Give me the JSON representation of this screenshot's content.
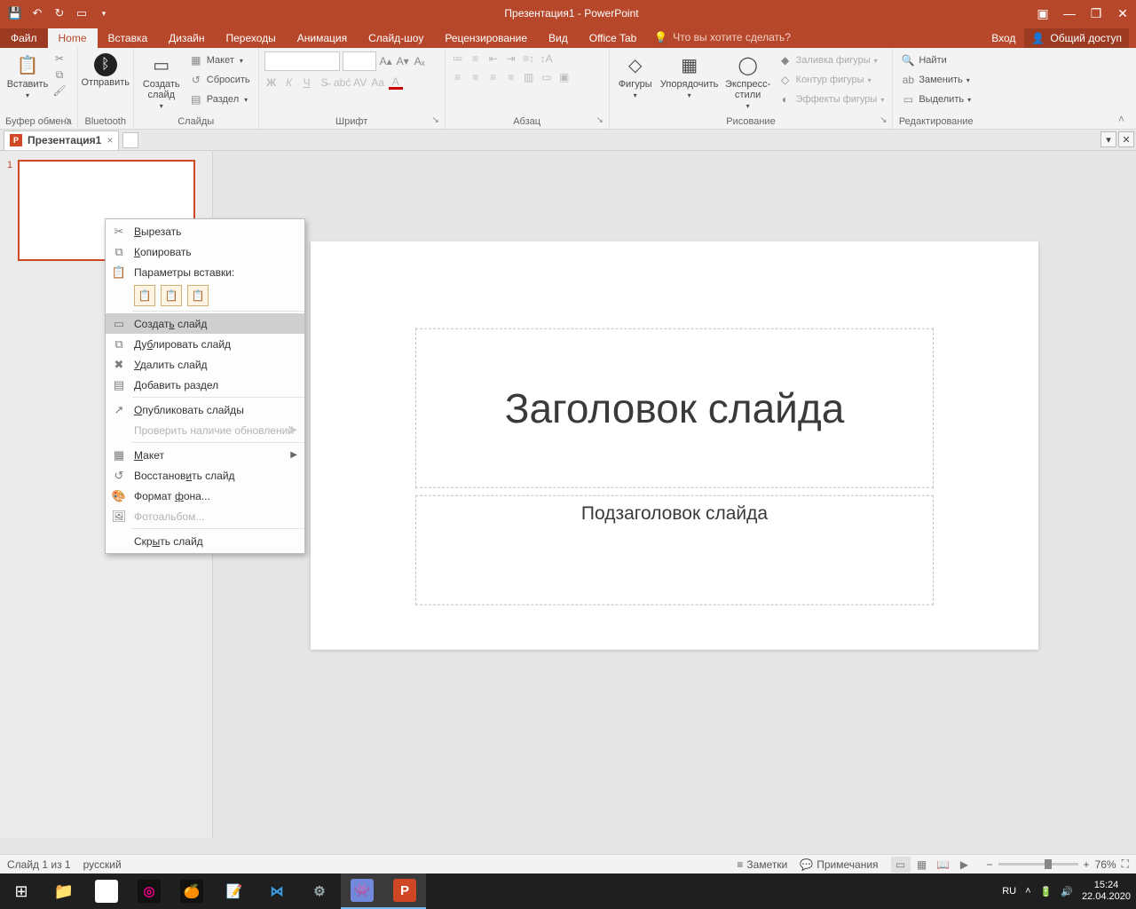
{
  "titlebar": {
    "title": "Презентация1 - PowerPoint"
  },
  "tabs": {
    "file": "Файл",
    "home": "Home",
    "insert": "Вставка",
    "design": "Дизайн",
    "transitions": "Переходы",
    "animations": "Анимация",
    "slideshow": "Слайд-шоу",
    "review": "Рецензирование",
    "view": "Вид",
    "officetab": "Office Tab",
    "tell": "Что вы хотите сделать?",
    "signin": "Вход",
    "share": "Общий доступ"
  },
  "ribbon": {
    "clipboard": {
      "label": "Буфер обмена",
      "paste": "Вставить"
    },
    "bluetooth": {
      "label": "Bluetooth",
      "send": "Отправить"
    },
    "slides": {
      "label": "Слайды",
      "newslide": "Создать\nслайд",
      "layout": "Макет",
      "reset": "Сбросить",
      "section": "Раздел"
    },
    "font": {
      "label": "Шрифт"
    },
    "paragraph": {
      "label": "Абзац"
    },
    "drawing": {
      "label": "Рисование",
      "shapes": "Фигуры",
      "arrange": "Упорядочить",
      "styles": "Экспресс-\nстили",
      "fill": "Заливка фигуры",
      "outline": "Контур фигуры",
      "effects": "Эффекты фигуры"
    },
    "editing": {
      "label": "Редактирование",
      "find": "Найти",
      "replace": "Заменить",
      "select": "Выделить"
    }
  },
  "doctab": {
    "name": "Презентация1"
  },
  "slide": {
    "number": "1",
    "title_placeholder": "Заголовок слайда",
    "subtitle_placeholder": "Подзаголовок слайда"
  },
  "context_menu": {
    "cut": "Вырезать",
    "copy": "Копировать",
    "paste_heading": "Параметры вставки:",
    "new_slide": "Создать слайд",
    "duplicate": "Дублировать слайд",
    "delete": "Удалить слайд",
    "add_section": "Добавить раздел",
    "publish": "Опубликовать слайды",
    "check_updates": "Проверить наличие обновлений",
    "layout": "Макет",
    "reset": "Восстановить слайд",
    "format_bg": "Формат фона...",
    "photo_album": "Фотоальбом...",
    "hide": "Скрыть слайд"
  },
  "statusbar": {
    "slideinfo": "Слайд 1 из 1",
    "lang": "русский",
    "notes": "Заметки",
    "comments": "Примечания",
    "zoom": "76%"
  },
  "tray": {
    "lang": "RU",
    "time": "15:24",
    "date": "22.04.2020"
  }
}
